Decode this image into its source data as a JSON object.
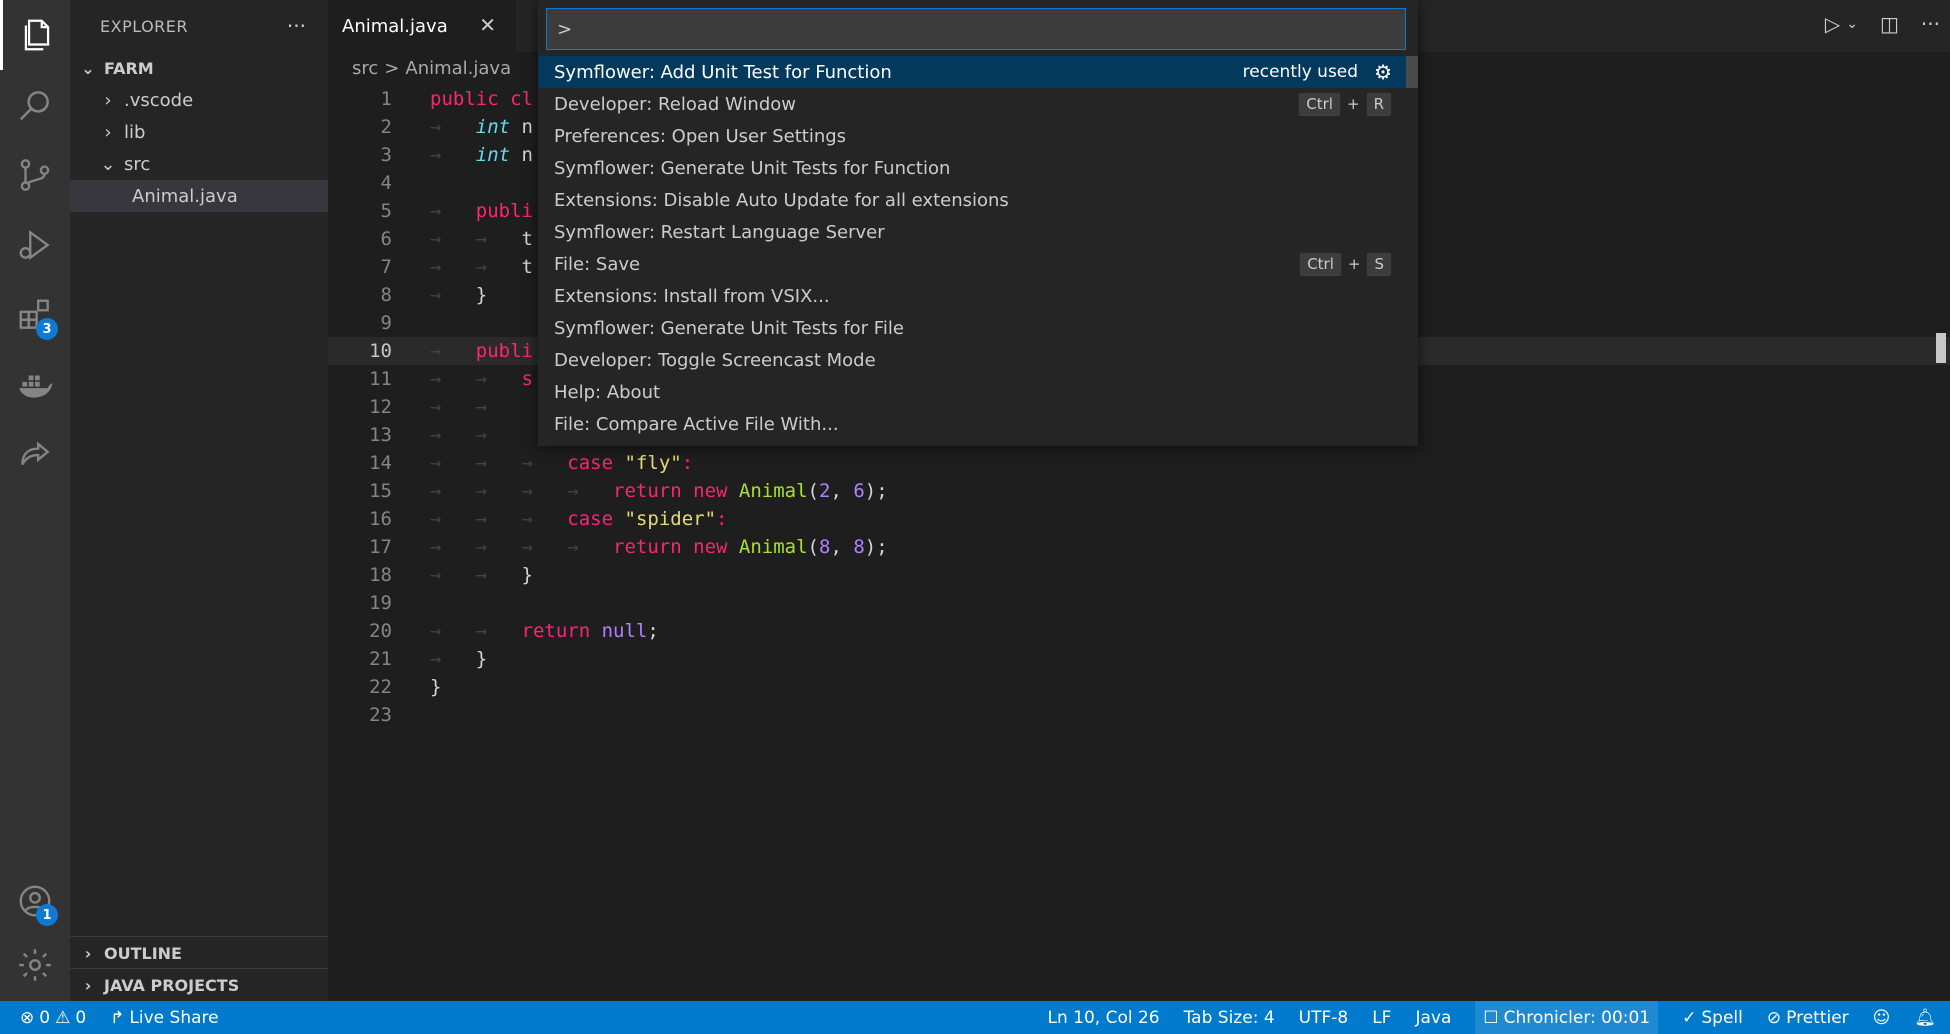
{
  "sidebar": {
    "title": "EXPLORER",
    "more": "···",
    "root": "FARM",
    "items": [
      {
        "label": ".vscode",
        "kind": "folder-collapsed"
      },
      {
        "label": "lib",
        "kind": "folder-collapsed"
      },
      {
        "label": "src",
        "kind": "folder-expanded"
      },
      {
        "label": "Animal.java",
        "kind": "file-selected"
      }
    ],
    "outline": "OUTLINE",
    "java_projects": "JAVA PROJECTS"
  },
  "activity": {
    "extensions_badge": "3",
    "accounts_badge": "1",
    "icons": [
      "files-icon",
      "search-icon",
      "source-control-icon",
      "run-debug-icon",
      "extensions-icon",
      "docker-icon",
      "live-share-icon",
      "accounts-icon",
      "settings-gear-icon"
    ]
  },
  "editor": {
    "tab_label": "Animal.java",
    "tab_close": "✕",
    "breadcrumb": [
      "src",
      "Animal.java"
    ],
    "breadcrumb_sep": ">",
    "current_line": 10
  },
  "palette": {
    "input_value": ">",
    "items": [
      {
        "label": "Symflower: Add Unit Test for Function",
        "hint": "recently used",
        "selected": true
      },
      {
        "label": "Developer: Reload Window",
        "keys": [
          "Ctrl",
          "R"
        ]
      },
      {
        "label": "Preferences: Open User Settings"
      },
      {
        "label": "Symflower: Generate Unit Tests for Function"
      },
      {
        "label": "Extensions: Disable Auto Update for all extensions"
      },
      {
        "label": "Symflower: Restart Language Server"
      },
      {
        "label": "File: Save",
        "keys": [
          "Ctrl",
          "S"
        ]
      },
      {
        "label": "Extensions: Install from VSIX..."
      },
      {
        "label": "Symflower: Generate Unit Tests for File"
      },
      {
        "label": "Developer: Toggle Screencast Mode"
      },
      {
        "label": "Help: About"
      },
      {
        "label": "File: Compare Active File With..."
      }
    ]
  },
  "status": {
    "errors": "0",
    "warnings": "0",
    "live_share": "Live Share",
    "position": "Ln 10, Col 26",
    "tab_size": "Tab Size: 4",
    "encoding": "UTF-8",
    "eol": "LF",
    "language": "Java",
    "chronicler": "Chronicler: 00:01",
    "spell": "Spell",
    "prettier": "Prettier"
  },
  "colors": {
    "accent": "#007acc",
    "selection": "#04395e",
    "keyword": "#f92672",
    "string": "#e6db74",
    "number": "#ae81ff",
    "class": "#a6e22e"
  }
}
